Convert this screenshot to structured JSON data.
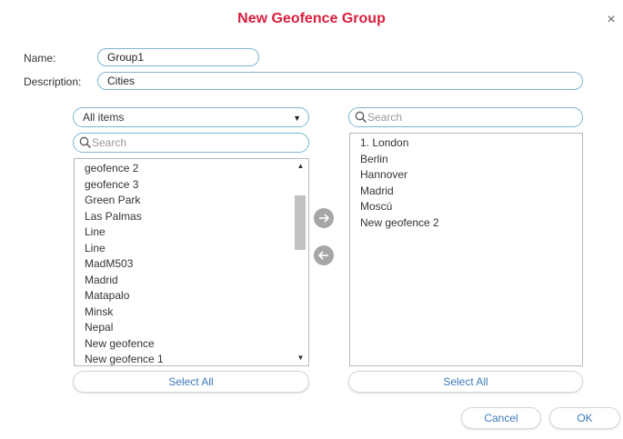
{
  "dialog": {
    "title": "New Geofence Group",
    "close_icon": "×"
  },
  "form": {
    "name_label": "Name:",
    "name_value": "Group1",
    "description_label": "Description:",
    "description_value": "Cities"
  },
  "left": {
    "filter_value": "All items",
    "search_placeholder": "Search",
    "items": [
      "geofence 2",
      "geofence 3",
      "Green Park",
      "Las Palmas",
      "Line",
      "Line",
      "MadM503",
      "Madrid",
      "Matapalo",
      "Minsk",
      "Nepal",
      "New geofence",
      "New geofence 1"
    ],
    "scroll_position": 0.18,
    "select_all_label": "Select All"
  },
  "right": {
    "search_placeholder": "Search",
    "items": [
      "1. London",
      "Berlin",
      "Hannover",
      "Madrid",
      "Moscú",
      "New geofence 2"
    ],
    "select_all_label": "Select All"
  },
  "transfer": {
    "add_icon": "arrow-right-icon",
    "remove_icon": "arrow-left-icon"
  },
  "footer": {
    "cancel_label": "Cancel",
    "ok_label": "OK"
  },
  "colors": {
    "title": "#d71f3c",
    "accent_border": "#7fb4d4",
    "button_text": "#3d7ab8",
    "transfer_button": "#a6a6a6"
  }
}
